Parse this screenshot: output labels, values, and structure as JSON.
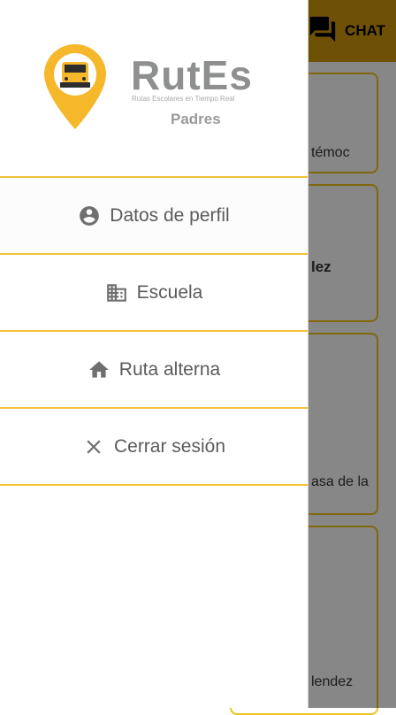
{
  "colors": {
    "accent": "#f2c23a",
    "appbar": "#d29a0c",
    "text": "#5b5b5b",
    "brand_gray": "#8e8f8f"
  },
  "appbar": {
    "chat_label": "CHAT",
    "chat_icon": "forum-icon"
  },
  "background_cards": [
    {
      "fragment": "témoc"
    },
    {
      "fragment": "lez"
    },
    {
      "fragment": "asa de la"
    },
    {
      "fragment": "lendez"
    }
  ],
  "drawer": {
    "brand": {
      "name": "RutEs",
      "tagline": "Rutas Escolares en Tiempo Real",
      "role": "Padres"
    },
    "menu": [
      {
        "label": "Datos de perfil",
        "icon": "account-circle-icon"
      },
      {
        "label": "Escuela",
        "icon": "building-icon"
      },
      {
        "label": "Ruta alterna",
        "icon": "home-icon"
      },
      {
        "label": "Cerrar sesión",
        "icon": "close-icon"
      }
    ]
  }
}
